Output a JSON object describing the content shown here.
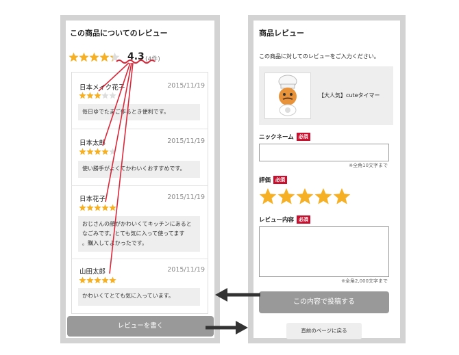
{
  "left_panel": {
    "title": "この商品についてのレビュー",
    "overall_rating": 4.3,
    "rating_text": "4.3",
    "count_text": "(4件)",
    "reviews": [
      {
        "name": "日本メイク花子",
        "date": "2015/11/19",
        "stars": 3,
        "comment": "毎日ゆでたまご作るとき便利です。"
      },
      {
        "name": "日本太郎",
        "date": "2015/11/19",
        "stars": 4,
        "comment": "使い勝手がよくてかわいくおすすめです。"
      },
      {
        "name": "日本花子",
        "date": "2015/11/19",
        "stars": 5,
        "comment_lines": [
          "おじさんの顔がかわいくてキッチンにあると",
          "なごみです。とても気に入って使ってます",
          "。購入してよかったです。"
        ]
      },
      {
        "name": "山田太郎",
        "date": "2015/11/19",
        "stars": 5,
        "comment": "かわいくてとても気に入っています。"
      }
    ],
    "write_button": "レビューを書く"
  },
  "right_panel": {
    "title": "商品レビュー",
    "intro": "この商品に対してのレビューをご入力ください。",
    "product_name": "【大人気】cuteタイマー",
    "nickname_label": "ニックネーム",
    "required_badge": "必須",
    "nickname_hint": "※全角10文字まで",
    "rating_label": "評価",
    "rating_value": 5,
    "content_label": "レビュー内容",
    "content_hint": "※全角2,000文字まで",
    "submit_button": "この内容で投稿する",
    "back_button": "直前のページに戻る"
  },
  "colors": {
    "star_filled": "#f5b026",
    "star_empty": "#dddddd",
    "required": "#c8102e",
    "button_gray": "#999999",
    "annotation_line": "#d8293a",
    "arrow": "#333333"
  },
  "icons": {
    "star": "star-icon",
    "arrow": "arrow-icon",
    "product": "chef-timer-image"
  }
}
